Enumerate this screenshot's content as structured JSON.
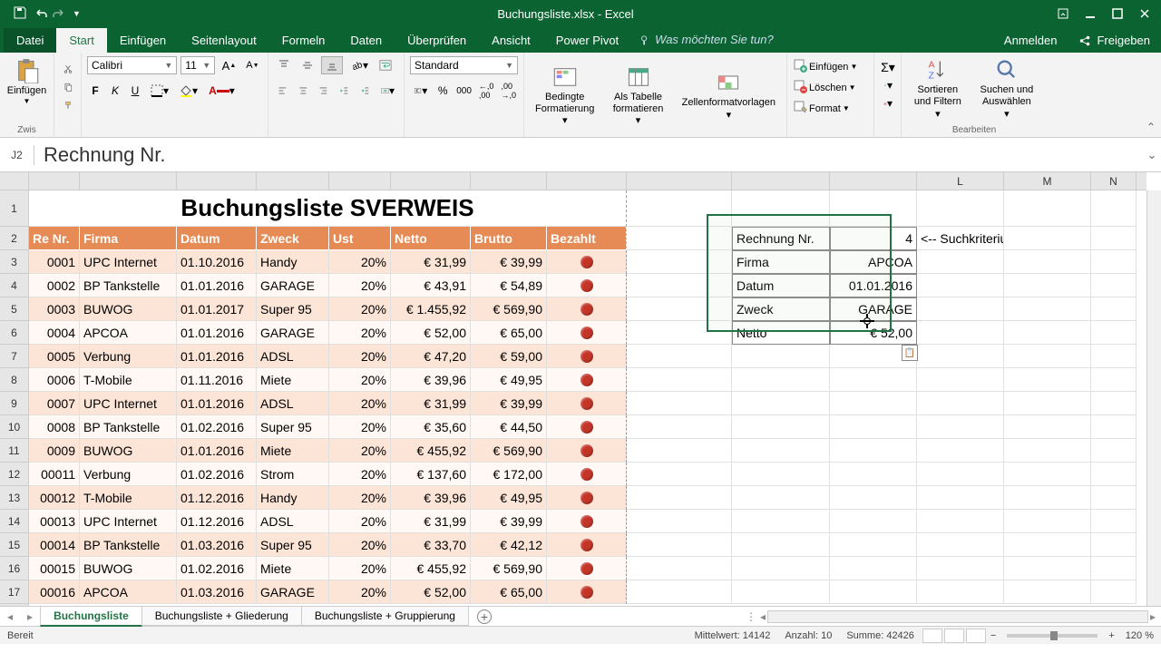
{
  "titlebar": {
    "title": "Buchungsliste.xlsx - Excel"
  },
  "tabs": {
    "file": "Datei",
    "home": "Start",
    "insert": "Einfügen",
    "pagelayout": "Seitenlayout",
    "formulas": "Formeln",
    "data": "Daten",
    "review": "Überprüfen",
    "view": "Ansicht",
    "powerpivot": "Power Pivot",
    "tell": "Was möchten Sie tun?",
    "signin": "Anmelden",
    "share": "Freigeben"
  },
  "ribbon": {
    "clipboard_label": "Zwis",
    "paste": "Einfügen",
    "font": "Calibri",
    "size": "11",
    "numfmt": "Standard",
    "condfmt": "Bedingte Formatierung",
    "astable": "Als Tabelle formatieren",
    "cellstyles": "Zellenformatvorlagen",
    "insert": "Einfügen",
    "delete": "Löschen",
    "format": "Format",
    "sortfilter": "Sortieren und Filtern",
    "findselect": "Suchen und Auswählen",
    "edit_label": "Bearbeiten"
  },
  "formula": {
    "namebox": "J2",
    "content": "Rechnung Nr."
  },
  "columns": [
    "",
    "",
    "",
    "",
    "",
    "",
    "",
    "",
    "",
    "",
    "",
    "L",
    "M",
    "N"
  ],
  "colwidths": [
    "wA",
    "wB",
    "wC",
    "wD",
    "wE",
    "wF",
    "wG",
    "wH",
    "wI",
    "wJ",
    "wK",
    "wL",
    "wM",
    "wN"
  ],
  "rows": [
    "1",
    "2",
    "3",
    "4",
    "5",
    "6",
    "7",
    "8",
    "9",
    "10",
    "11",
    "12",
    "13",
    "14",
    "15",
    "16",
    "17"
  ],
  "title_cell": "Buchungsliste SVERWEIS",
  "headers": [
    "Re Nr.",
    "Firma",
    "Datum",
    "Zweck",
    "Ust",
    "Netto",
    "Brutto",
    "Bezahlt"
  ],
  "table": [
    {
      "re": "0001",
      "firma": "UPC Internet",
      "datum": "01.10.2016",
      "zweck": "Handy",
      "ust": "20%",
      "netto": "€      31,99",
      "brutto": "€ 39,99"
    },
    {
      "re": "0002",
      "firma": "BP Tankstelle",
      "datum": "01.01.2016",
      "zweck": "GARAGE",
      "ust": "20%",
      "netto": "€      43,91",
      "brutto": "€ 54,89"
    },
    {
      "re": "0003",
      "firma": "BUWOG",
      "datum": "01.01.2017",
      "zweck": "Super 95",
      "ust": "20%",
      "netto": "€ 1.455,92",
      "brutto": "€ 569,90"
    },
    {
      "re": "0004",
      "firma": "APCOA",
      "datum": "01.01.2016",
      "zweck": "GARAGE",
      "ust": "20%",
      "netto": "€      52,00",
      "brutto": "€ 65,00"
    },
    {
      "re": "0005",
      "firma": "Verbung",
      "datum": "01.01.2016",
      "zweck": "ADSL",
      "ust": "20%",
      "netto": "€      47,20",
      "brutto": "€ 59,00"
    },
    {
      "re": "0006",
      "firma": "T-Mobile",
      "datum": "01.11.2016",
      "zweck": "Miete",
      "ust": "20%",
      "netto": "€      39,96",
      "brutto": "€ 49,95"
    },
    {
      "re": "0007",
      "firma": "UPC Internet",
      "datum": "01.01.2016",
      "zweck": "ADSL",
      "ust": "20%",
      "netto": "€      31,99",
      "brutto": "€ 39,99"
    },
    {
      "re": "0008",
      "firma": "BP Tankstelle",
      "datum": "01.02.2016",
      "zweck": "Super 95",
      "ust": "20%",
      "netto": "€      35,60",
      "brutto": "€ 44,50"
    },
    {
      "re": "0009",
      "firma": "BUWOG",
      "datum": "01.01.2016",
      "zweck": "Miete",
      "ust": "20%",
      "netto": "€    455,92",
      "brutto": "€ 569,90"
    },
    {
      "re": "00011",
      "firma": "Verbung",
      "datum": "01.02.2016",
      "zweck": "Strom",
      "ust": "20%",
      "netto": "€    137,60",
      "brutto": "€ 172,00"
    },
    {
      "re": "00012",
      "firma": "T-Mobile",
      "datum": "01.12.2016",
      "zweck": "Handy",
      "ust": "20%",
      "netto": "€      39,96",
      "brutto": "€ 49,95"
    },
    {
      "re": "00013",
      "firma": "UPC Internet",
      "datum": "01.12.2016",
      "zweck": "ADSL",
      "ust": "20%",
      "netto": "€      31,99",
      "brutto": "€ 39,99"
    },
    {
      "re": "00014",
      "firma": "BP Tankstelle",
      "datum": "01.03.2016",
      "zweck": "Super 95",
      "ust": "20%",
      "netto": "€      33,70",
      "brutto": "€ 42,12"
    },
    {
      "re": "00015",
      "firma": "BUWOG",
      "datum": "01.02.2016",
      "zweck": "Miete",
      "ust": "20%",
      "netto": "€    455,92",
      "brutto": "€ 569,90"
    },
    {
      "re": "00016",
      "firma": "APCOA",
      "datum": "01.03.2016",
      "zweck": "GARAGE",
      "ust": "20%",
      "netto": "€      52,00",
      "brutto": "€ 65,00"
    }
  ],
  "lookup": {
    "label_rnr": "Rechnung Nr.",
    "val_rnr": "4",
    "hint": "<-- Suchkriterium",
    "label_firma": "Firma",
    "val_firma": "APCOA",
    "label_datum": "Datum",
    "val_datum": "01.01.2016",
    "label_zweck": "Zweck",
    "val_zweck": "GARAGE",
    "label_netto": "Netto",
    "val_netto": "€ 52,00"
  },
  "sheets": {
    "s1": "Buchungsliste",
    "s2": "Buchungsliste + Gliederung",
    "s3": "Buchungsliste + Gruppierung"
  },
  "status": {
    "ready": "Bereit",
    "avg": "Mittelwert: 14142",
    "count": "Anzahl: 10",
    "sum": "Summe: 42426",
    "zoom_minus": "−",
    "zoom_plus": "+",
    "zoom": "120 %"
  }
}
